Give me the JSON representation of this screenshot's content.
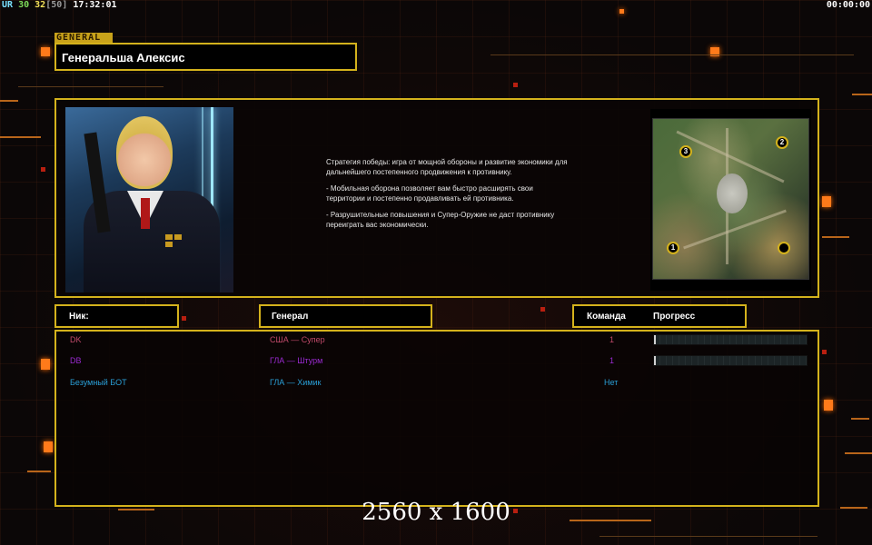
{
  "hud": {
    "tag": "UR",
    "value_a": "30",
    "value_b": "32",
    "value_c": "[50]",
    "clock": "17:32:01",
    "timer": "00:00:00"
  },
  "general": {
    "tag": "GENERAL",
    "name": "Генеральша Алексис",
    "strategy": [
      "Стратегия победы: игра от мощной обороны и развитие экономики для дальнейшего постепенного продвижения к противнику.",
      "- Мобильная оборона позволяет вам быстро расширять свои территории и постепенно продавливать ей противника.",
      "- Разрушительные повышения и Супер-Оружие не даст противнику переиграть вас экономически."
    ]
  },
  "minimap": {
    "markers": [
      "1",
      "2",
      "3",
      ""
    ]
  },
  "columns": {
    "nick": "Ник:",
    "general": "Генерал",
    "team": "Команда",
    "progress": "Прогресс"
  },
  "players": [
    {
      "nick": "DK",
      "general": "США — Супер",
      "team": "1",
      "progress": 0.01,
      "color": "#c04a6a"
    },
    {
      "nick": "DB",
      "general": "ГЛА — Штурм",
      "team": "1",
      "progress": 0.01,
      "color": "#9a2ad0"
    },
    {
      "nick": "Безумный БОТ",
      "general": "ГЛА — Химик",
      "team": "Нет",
      "progress": 0,
      "color": "#2aa0d8"
    }
  ],
  "watermark": "2560 x 1600"
}
